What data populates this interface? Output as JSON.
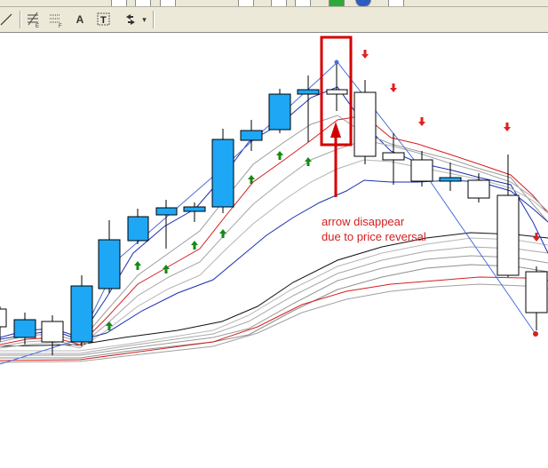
{
  "toolbar": {
    "text_tool_label": "A",
    "text_label_tool_label": "T",
    "more_tools_label": "▾",
    "icons": [
      "line-tool-icon",
      "fibonacci-expansion-icon",
      "fibonacci-fan-icon",
      "text-icon",
      "text-label-icon",
      "arrows-icon",
      "dropdown-icon"
    ]
  },
  "annotation": {
    "line1": "arrow disappear",
    "line2": "due to price reversal"
  },
  "colors": {
    "bull_candle": "#1ea7f5",
    "bear_candle": "#ffffff",
    "up_arrow": "#138a13",
    "down_arrow": "#e02020",
    "highlight": "#d40000",
    "ma_blue": "#1a2fb0",
    "ma_red": "#d42020",
    "ma_gray": "#9a9a9a",
    "ma_black": "#111111"
  }
}
